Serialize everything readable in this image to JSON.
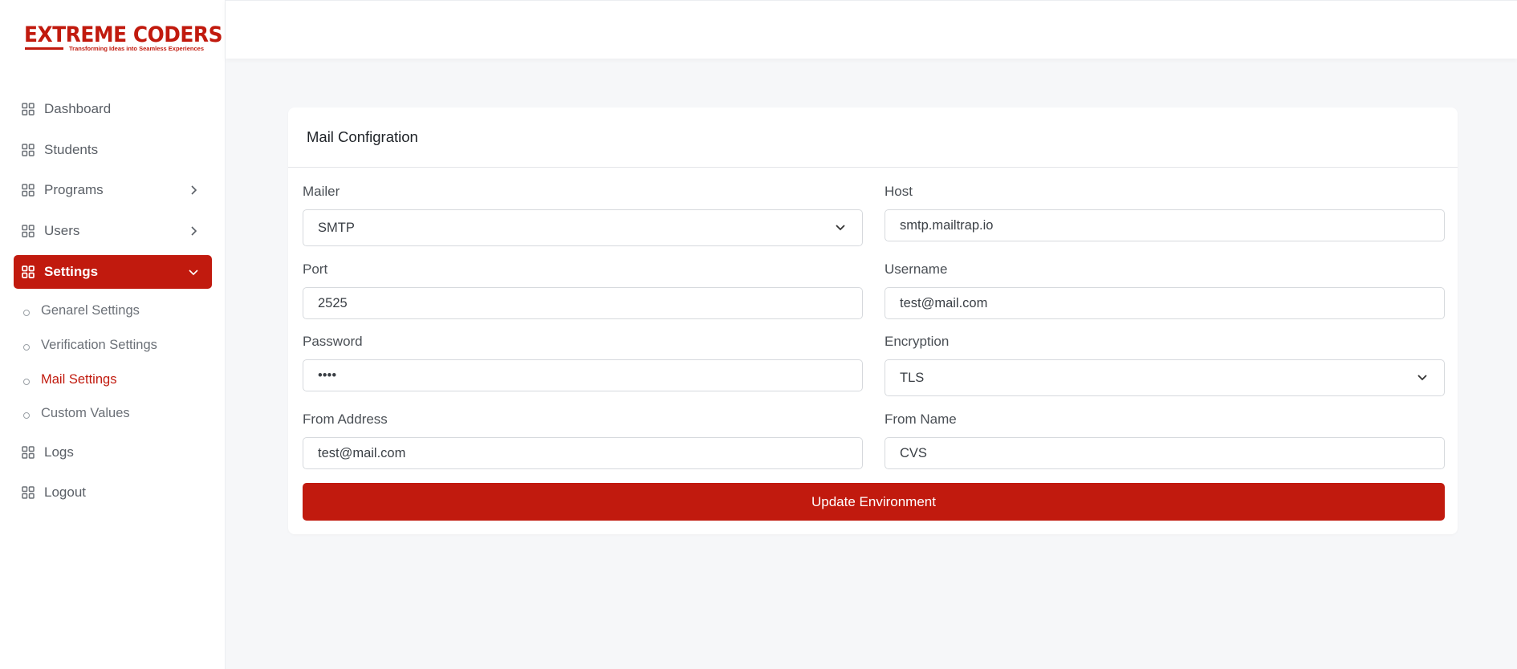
{
  "brand": {
    "name": "EXTREME CODERS",
    "tagline": "Transforming Ideas into Seamless Experiences",
    "accent_color": "#c11a0e"
  },
  "sidebar": {
    "items": [
      {
        "label": "Dashboard",
        "icon": "grid-icon"
      },
      {
        "label": "Students",
        "icon": "grid-icon"
      },
      {
        "label": "Programs",
        "icon": "grid-icon",
        "chevron": "chevron-right-icon"
      },
      {
        "label": "Users",
        "icon": "grid-icon",
        "chevron": "chevron-right-icon"
      },
      {
        "label": "Settings",
        "icon": "grid-icon",
        "chevron": "chevron-down-icon",
        "active": true
      },
      {
        "label": "Logs",
        "icon": "grid-icon"
      },
      {
        "label": "Logout",
        "icon": "grid-icon"
      }
    ],
    "settings_subitems": [
      {
        "label": "Genarel Settings"
      },
      {
        "label": "Verification Settings"
      },
      {
        "label": "Mail Settings",
        "active": true
      },
      {
        "label": "Custom Values"
      }
    ]
  },
  "card": {
    "title": "Mail Configration",
    "fields": {
      "mailer": {
        "label": "Mailer",
        "value": "SMTP"
      },
      "host": {
        "label": "Host",
        "value": "smtp.mailtrap.io"
      },
      "port": {
        "label": "Port",
        "value": "2525"
      },
      "username": {
        "label": "Username",
        "value": "test@mail.com"
      },
      "password": {
        "label": "Password",
        "value": "••••"
      },
      "encryption": {
        "label": "Encryption",
        "value": "TLS"
      },
      "from_address": {
        "label": "From Address",
        "value": "test@mail.com"
      },
      "from_name": {
        "label": "From Name",
        "value": "CVS"
      }
    },
    "submit_label": "Update Environment"
  }
}
